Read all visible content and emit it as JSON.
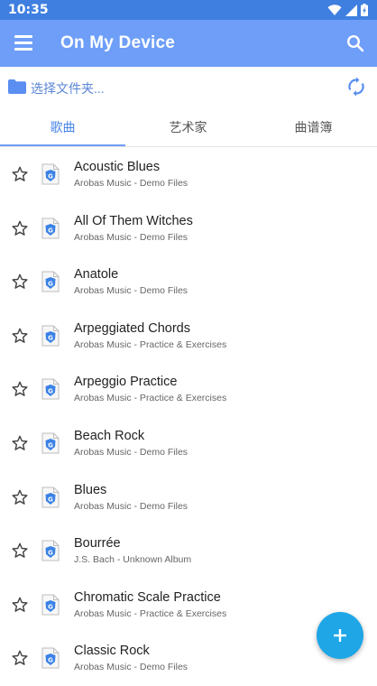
{
  "status_bar": {
    "time": "10:35"
  },
  "app_bar": {
    "title": "On My Device"
  },
  "folder_bar": {
    "label": "选择文件夹..."
  },
  "tabs": [
    {
      "label": "歌曲",
      "active": true
    },
    {
      "label": "艺术家",
      "active": false
    },
    {
      "label": "曲谱簿",
      "active": false
    }
  ],
  "songs": [
    {
      "title": "Acoustic Blues",
      "subtitle": "Arobas Music - Demo Files"
    },
    {
      "title": "All Of Them Witches",
      "subtitle": "Arobas Music - Demo Files"
    },
    {
      "title": "Anatole",
      "subtitle": "Arobas Music - Demo Files"
    },
    {
      "title": "Arpeggiated Chords",
      "subtitle": "Arobas Music - Practice & Exercises"
    },
    {
      "title": "Arpeggio Practice",
      "subtitle": "Arobas Music - Practice & Exercises"
    },
    {
      "title": "Beach Rock",
      "subtitle": "Arobas Music - Demo Files"
    },
    {
      "title": "Blues",
      "subtitle": "Arobas Music - Demo Files"
    },
    {
      "title": "Bourrée",
      "subtitle": "J.S. Bach - Unknown Album"
    },
    {
      "title": "Chromatic Scale Practice",
      "subtitle": "Arobas Music - Practice & Exercises"
    },
    {
      "title": "Classic Rock",
      "subtitle": "Arobas Music - Demo Files"
    }
  ],
  "icons": {
    "menu": "hamburger-menu-icon",
    "search": "search-icon",
    "folder": "folder-icon",
    "sync": "sync-icon",
    "star": "star-outline-icon",
    "file": "guitar-pro-file-icon",
    "fab": "plus-icon"
  },
  "colors": {
    "status_bar": "#3f7fe0",
    "app_bar": "#6e9ef7",
    "accent": "#4a86e8",
    "fab": "#1ea6e6"
  }
}
